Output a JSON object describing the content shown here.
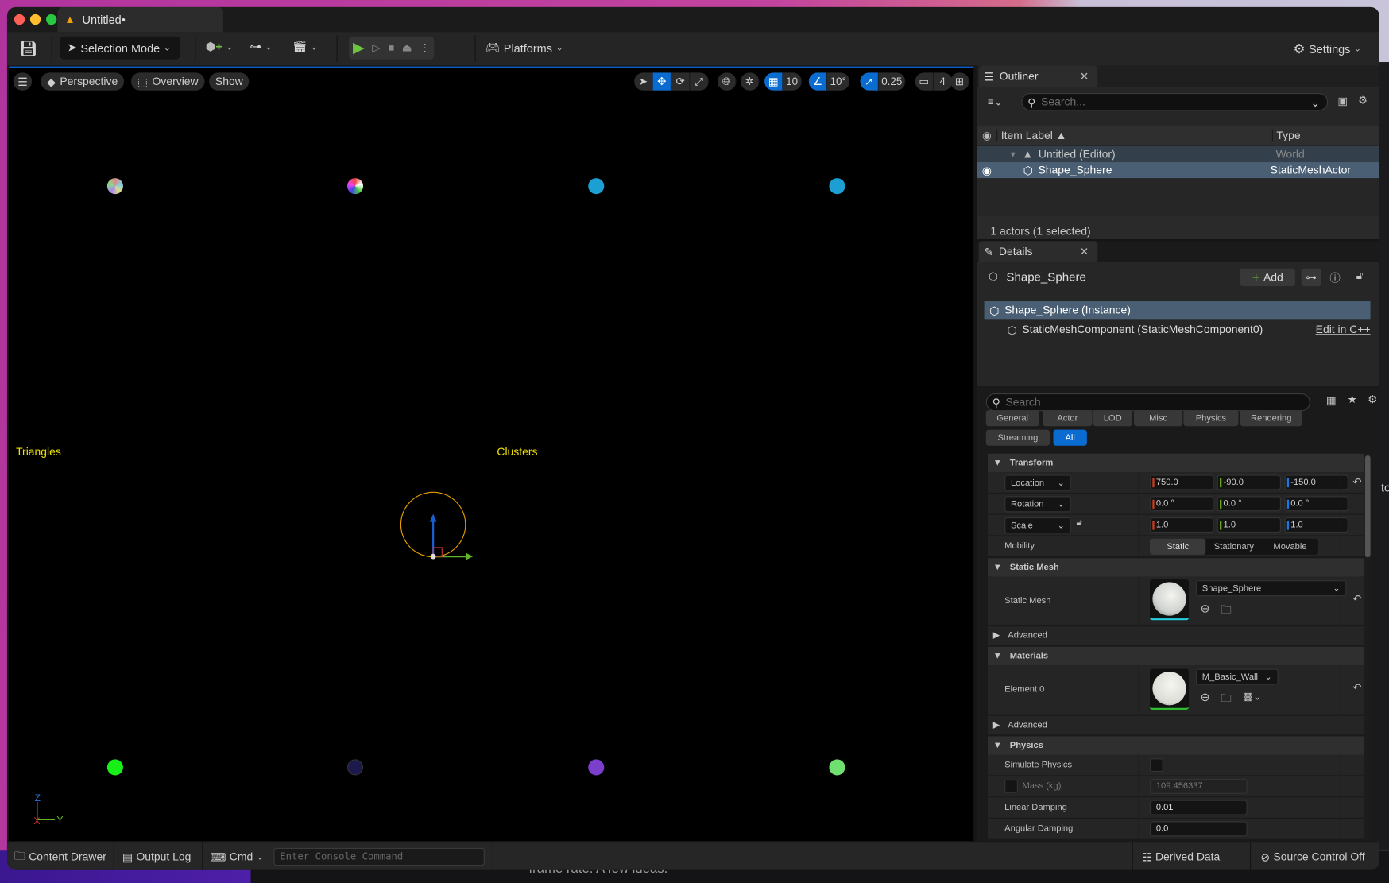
{
  "window": {
    "tab_title": "Untitled•"
  },
  "toolbar": {
    "selection_mode": "Selection Mode",
    "platforms": "Platforms",
    "settings": "Settings"
  },
  "viewport": {
    "menu_label": "Perspective",
    "overview": "Overview",
    "show": "Show",
    "grid_snap": "10",
    "rotation_snap": "10°",
    "scale_snap": "0.25",
    "camera_speed": "4",
    "label_triangles": "Triangles",
    "label_clusters": "Clusters",
    "axis_z": "Z",
    "axis_y": "Y",
    "axis_x": "X",
    "colors": {
      "top": [
        "#multi",
        "#multi",
        "#1c9fd2",
        "#1c9fd2"
      ],
      "bottom": [
        "#18ee18",
        "#1c1a4c",
        "#7b3fcb",
        "#6fe06f"
      ],
      "label": "#f0e000",
      "selection_ring": "#e8a000"
    }
  },
  "outliner": {
    "tab": "Outliner",
    "search_placeholder": "Search...",
    "col_label": "Item Label ▲",
    "col_type": "Type",
    "rows": [
      {
        "label": "Untitled (Editor)",
        "type": "World"
      },
      {
        "label": "Shape_Sphere",
        "type": "StaticMeshActor"
      }
    ],
    "status": "1 actors (1 selected)"
  },
  "details": {
    "tab": "Details",
    "actor_name": "Shape_Sphere",
    "add": "Add",
    "components": [
      {
        "label": "Shape_Sphere (Instance)"
      },
      {
        "label": "StaticMeshComponent (StaticMeshComponent0)",
        "link": "Edit in C++"
      }
    ],
    "search_placeholder": "Search",
    "categories": [
      "General",
      "Actor",
      "LOD",
      "Misc",
      "Physics",
      "Rendering",
      "Streaming",
      "All"
    ],
    "transform": {
      "title": "Transform",
      "location": {
        "label": "Location",
        "x": "750.0",
        "y": "-90.0",
        "z": "-150.0"
      },
      "rotation": {
        "label": "Rotation",
        "x": "0.0 °",
        "y": "0.0 °",
        "z": "0.0 °"
      },
      "scale": {
        "label": "Scale",
        "x": "1.0",
        "y": "1.0",
        "z": "1.0"
      },
      "mobility": {
        "label": "Mobility",
        "options": [
          "Static",
          "Stationary",
          "Movable"
        ],
        "selected": "Static"
      }
    },
    "static_mesh": {
      "title": "Static Mesh",
      "label": "Static Mesh",
      "value": "Shape_Sphere",
      "advanced": "Advanced"
    },
    "materials": {
      "title": "Materials",
      "label": "Element 0",
      "value": "M_Basic_Wall",
      "advanced": "Advanced"
    },
    "physics": {
      "title": "Physics",
      "simulate": "Simulate Physics",
      "mass_label": "Mass (kg)",
      "mass": "109.456337",
      "linear_label": "Linear Damping",
      "linear": "0.01",
      "angular_label": "Angular Damping",
      "angular": "0.0"
    }
  },
  "bottombar": {
    "content_drawer": "Content Drawer",
    "output_log": "Output Log",
    "cmd": "Cmd",
    "console_placeholder": "Enter Console Command",
    "derived_data": "Derived Data",
    "source_control": "Source Control Off"
  },
  "background": {
    "text": "frame rate. A few ideas.",
    "side_text": "to"
  }
}
